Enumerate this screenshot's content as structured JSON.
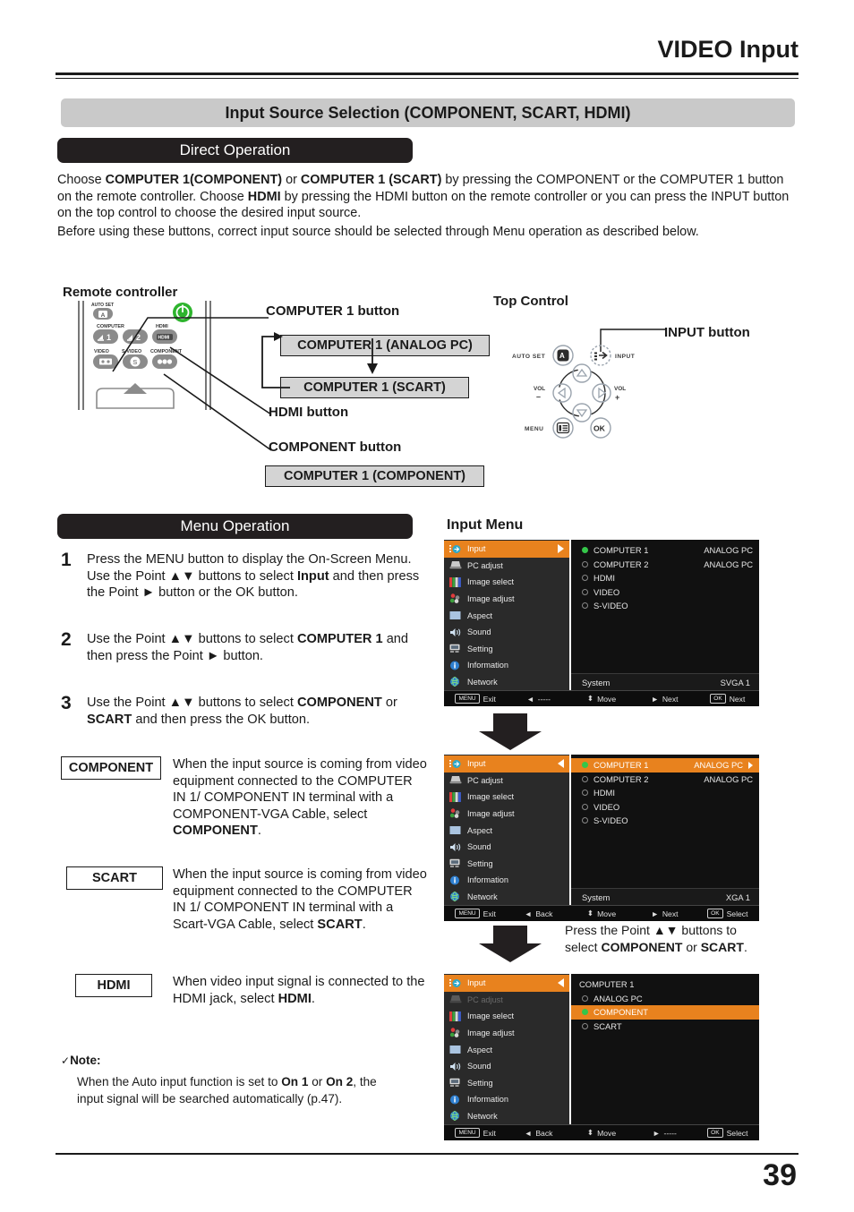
{
  "header": {
    "title": "VIDEO Input"
  },
  "section": {
    "bar_label": "Input Source Selection (COMPONENT, SCART, HDMI)"
  },
  "direct_operation": {
    "pill_label": "Direct Operation",
    "para1_a": "Choose ",
    "para1_b": "COMPUTER 1(COMPONENT)",
    "para1_c": " or ",
    "para1_d": "COMPUTER 1 (SCART)",
    "para1_e": " by pressing the COMPONENT or the COMPUTER 1 button on the remote controller. Choose ",
    "para1_f": "HDMI",
    "para1_g": " by pressing the HDMI button on the remote controller or you can press the INPUT button on the top control to choose the desired input source.",
    "para2": "Before using these buttons, correct input source should be selected through Menu operation as described below."
  },
  "diagram": {
    "remote_label": "Remote controller",
    "topcontrol_label": "Top Control",
    "callout_computer1": "COMPUTER 1 button",
    "callout_hdmi": "HDMI button",
    "callout_component": "COMPONENT button",
    "callout_input": "INPUT button",
    "box_analog_pc": "COMPUTER 1 (ANALOG PC)",
    "box_scart": "COMPUTER 1 (SCART)",
    "box_component": "COMPUTER 1 (COMPONENT)",
    "remote_keys": {
      "auto_set": "AUTO SET",
      "computer": "COMPUTER",
      "hdmi": "HDMI",
      "video": "VIDEO",
      "svideo": "S-VIDEO",
      "component": "COMPONENT",
      "key1": "1",
      "key2": "2",
      "hdmi_glyph": "HDMI"
    },
    "topcontrol_keys": {
      "auto_set": "AUTO SET",
      "input": "INPUT",
      "vol_minus_label": "VOL",
      "vol_minus_sign": "–",
      "vol_plus_label": "VOL",
      "vol_plus_sign": "+",
      "menu": "MENU",
      "ok": "OK"
    }
  },
  "menu_operation": {
    "pill_label": "Menu Operation",
    "steps": [
      {
        "num": "1",
        "a": "Press the MENU button to display the On-Screen Menu. Use the Point ▲▼ buttons to select ",
        "b": "Input",
        "c": " and then press the Point ► button or the OK button."
      },
      {
        "num": "2",
        "a": "Use the Point ▲▼ buttons to select ",
        "b": "COMPUTER 1",
        "c": " and then press the Point ► button."
      },
      {
        "num": "3",
        "a": "Use the Point ▲▼ buttons to select ",
        "b": "COMPONENT",
        "c": " or ",
        "d": "SCART",
        "e": " and then press the OK button."
      }
    ]
  },
  "definitions": [
    {
      "key": "COMPONENT",
      "body_a": "When the input source is coming from video equipment connected to the COMPUTER IN 1/ COMPONENT IN terminal with a COMPONENT-VGA Cable, select ",
      "body_b": "COMPONENT",
      "body_c": "."
    },
    {
      "key": "SCART",
      "body_a": "When the input source is coming from video equipment connected to the COMPUTER IN 1/ COMPONENT IN terminal with a Scart-VGA Cable, select ",
      "body_b": "SCART",
      "body_c": "."
    },
    {
      "key": "HDMI",
      "body_a": "When video input signal is connected to the HDMI jack, select ",
      "body_b": "HDMI",
      "body_c": "."
    }
  ],
  "note": {
    "check": "✓",
    "heading": "Note:",
    "body_a": "When the Auto input function is set to ",
    "body_b": "On 1",
    "body_c": " or ",
    "body_d": "On 2",
    "body_e": ", the input signal will be searched automatically (p.47)."
  },
  "input_menu": {
    "label": "Input Menu",
    "caption_a": "Press the Point ▲▼ buttons to select ",
    "caption_b": "COMPONENT",
    "caption_c": " or ",
    "caption_d": "SCART",
    "caption_e": ".",
    "sidebar": [
      {
        "label": "Input",
        "icon": "input-icon"
      },
      {
        "label": "PC adjust",
        "icon": "pc-adjust-icon"
      },
      {
        "label": "Image select",
        "icon": "image-select-icon"
      },
      {
        "label": "Image adjust",
        "icon": "image-adjust-icon"
      },
      {
        "label": "Aspect",
        "icon": "aspect-icon"
      },
      {
        "label": "Sound",
        "icon": "sound-icon"
      },
      {
        "label": "Setting",
        "icon": "setting-icon"
      },
      {
        "label": "Information",
        "icon": "information-icon"
      },
      {
        "label": "Network",
        "icon": "network-icon"
      }
    ],
    "screens": [
      {
        "id": "menu-1",
        "rows": [
          {
            "label": "COMPUTER 1",
            "value": "ANALOG PC",
            "selected_dot": true,
            "highlight": false
          },
          {
            "label": "COMPUTER 2",
            "value": "ANALOG PC",
            "selected_dot": false,
            "highlight": false
          },
          {
            "label": "HDMI",
            "value": "",
            "selected_dot": false,
            "highlight": false
          },
          {
            "label": "VIDEO",
            "value": "",
            "selected_dot": false,
            "highlight": false
          },
          {
            "label": "S-VIDEO",
            "value": "",
            "selected_dot": false,
            "highlight": false
          }
        ],
        "system_label": "System",
        "system_value": "SVGA 1",
        "bottom": [
          {
            "key": "MENU",
            "label": "Exit"
          },
          {
            "key": "◄",
            "label": "-----"
          },
          {
            "key": "⬍",
            "label": "Move"
          },
          {
            "key": "►",
            "label": "Next"
          },
          {
            "key": "OK",
            "label": "Next"
          }
        ]
      },
      {
        "id": "menu-2",
        "rows": [
          {
            "label": "COMPUTER 1",
            "value": "ANALOG PC",
            "selected_dot": true,
            "highlight": true
          },
          {
            "label": "COMPUTER 2",
            "value": "ANALOG PC",
            "selected_dot": false,
            "highlight": false
          },
          {
            "label": "HDMI",
            "value": "",
            "selected_dot": false,
            "highlight": false
          },
          {
            "label": "VIDEO",
            "value": "",
            "selected_dot": false,
            "highlight": false
          },
          {
            "label": "S-VIDEO",
            "value": "",
            "selected_dot": false,
            "highlight": false
          }
        ],
        "system_label": "System",
        "system_value": "XGA 1",
        "bottom": [
          {
            "key": "MENU",
            "label": "Exit"
          },
          {
            "key": "◄",
            "label": "Back"
          },
          {
            "key": "⬍",
            "label": "Move"
          },
          {
            "key": "►",
            "label": "Next"
          },
          {
            "key": "OK",
            "label": "Select"
          }
        ]
      },
      {
        "id": "menu-3",
        "title": "COMPUTER 1",
        "rows": [
          {
            "label": "ANALOG PC",
            "value": "",
            "selected_dot": false,
            "highlight": false
          },
          {
            "label": "COMPONENT",
            "value": "",
            "selected_dot": true,
            "highlight": true
          },
          {
            "label": "SCART",
            "value": "",
            "selected_dot": false,
            "highlight": false
          }
        ],
        "bottom": [
          {
            "key": "MENU",
            "label": "Exit"
          },
          {
            "key": "◄",
            "label": "Back"
          },
          {
            "key": "⬍",
            "label": "Move"
          },
          {
            "key": "►",
            "label": "-----"
          },
          {
            "key": "OK",
            "label": "Select"
          }
        ]
      }
    ]
  },
  "footer": {
    "page_number": "39"
  },
  "colors": {
    "osd_highlight": "#e8821e",
    "osd_sidebar": "#2a2a2a",
    "osd_panel": "#111111",
    "green_dot": "#35c64a",
    "gray_box": "#d4d4d4",
    "section_bar": "#c9c9c9",
    "pill": "#231f20"
  }
}
